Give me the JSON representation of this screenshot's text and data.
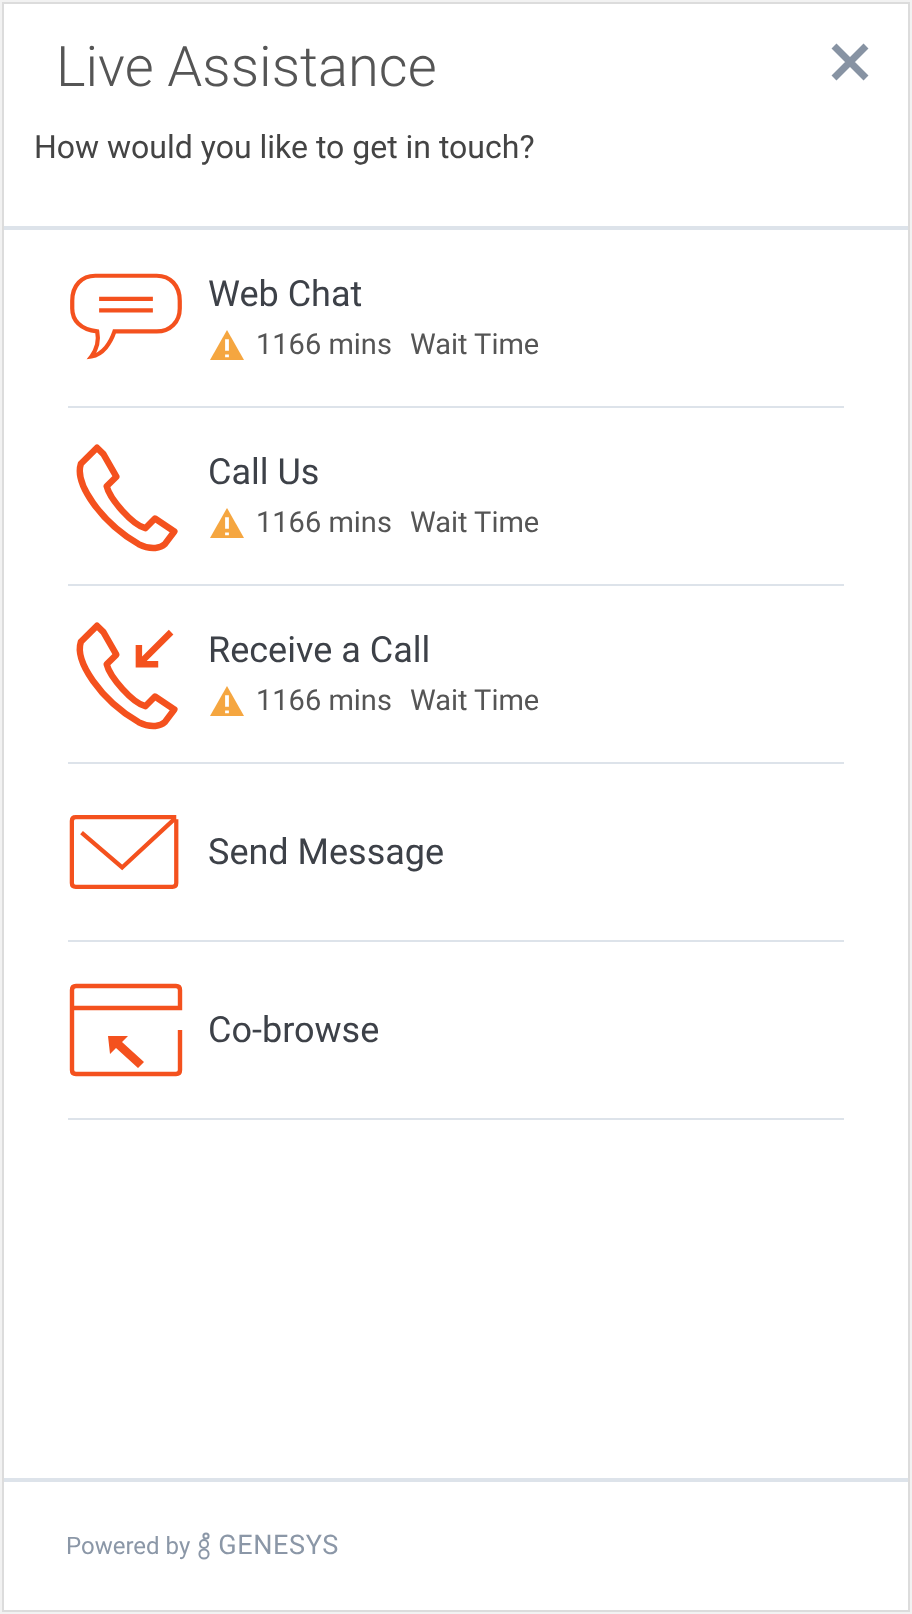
{
  "header": {
    "title": "Live Assistance",
    "prompt": "How would you like to get in touch?"
  },
  "options": [
    {
      "kind": "chat",
      "label": "Web Chat",
      "wait": {
        "value": "1166 mins",
        "label": "Wait Time"
      }
    },
    {
      "kind": "call",
      "label": "Call Us",
      "wait": {
        "value": "1166 mins",
        "label": "Wait Time"
      }
    },
    {
      "kind": "callback",
      "label": "Receive a Call",
      "wait": {
        "value": "1166 mins",
        "label": "Wait Time"
      }
    },
    {
      "kind": "message",
      "label": "Send Message"
    },
    {
      "kind": "cobrowse",
      "label": "Co-browse"
    }
  ],
  "footer": {
    "powered_by": "Powered by",
    "brand": "GENESYS"
  }
}
